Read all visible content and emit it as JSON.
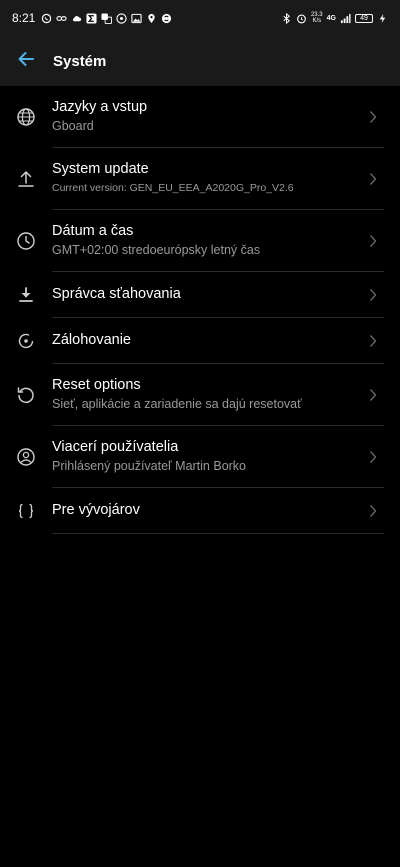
{
  "status_bar": {
    "time": "8:21",
    "net_speed_value": "23.3",
    "net_speed_unit": "K/s",
    "network_type": "4G",
    "battery_level": "49"
  },
  "app_bar": {
    "title": "Systém",
    "back_icon": "arrow-left-icon",
    "accent_color": "#4fb3e8"
  },
  "items": [
    {
      "icon": "globe-icon",
      "title": "Jazyky a vstup",
      "subtitle": "Gboard"
    },
    {
      "icon": "system-update-icon",
      "title": "System update",
      "subtitle": "Current version: GEN_EU_EEA_A2020G_Pro_V2.6"
    },
    {
      "icon": "clock-icon",
      "title": "Dátum a čas",
      "subtitle": "GMT+02:00 stredoeurópsky letný čas"
    },
    {
      "icon": "download-icon",
      "title": "Správca sťahovania",
      "subtitle": ""
    },
    {
      "icon": "backup-icon",
      "title": "Zálohovanie",
      "subtitle": ""
    },
    {
      "icon": "reset-icon",
      "title": "Reset options",
      "subtitle": "Sieť, aplikácie a zariadenie sa dajú resetovať"
    },
    {
      "icon": "user-icon",
      "title": "Viacerí používatelia",
      "subtitle": "Prihlásený používateľ Martin Borko"
    },
    {
      "icon": "braces-icon",
      "title": "Pre vývojárov",
      "subtitle": ""
    }
  ]
}
